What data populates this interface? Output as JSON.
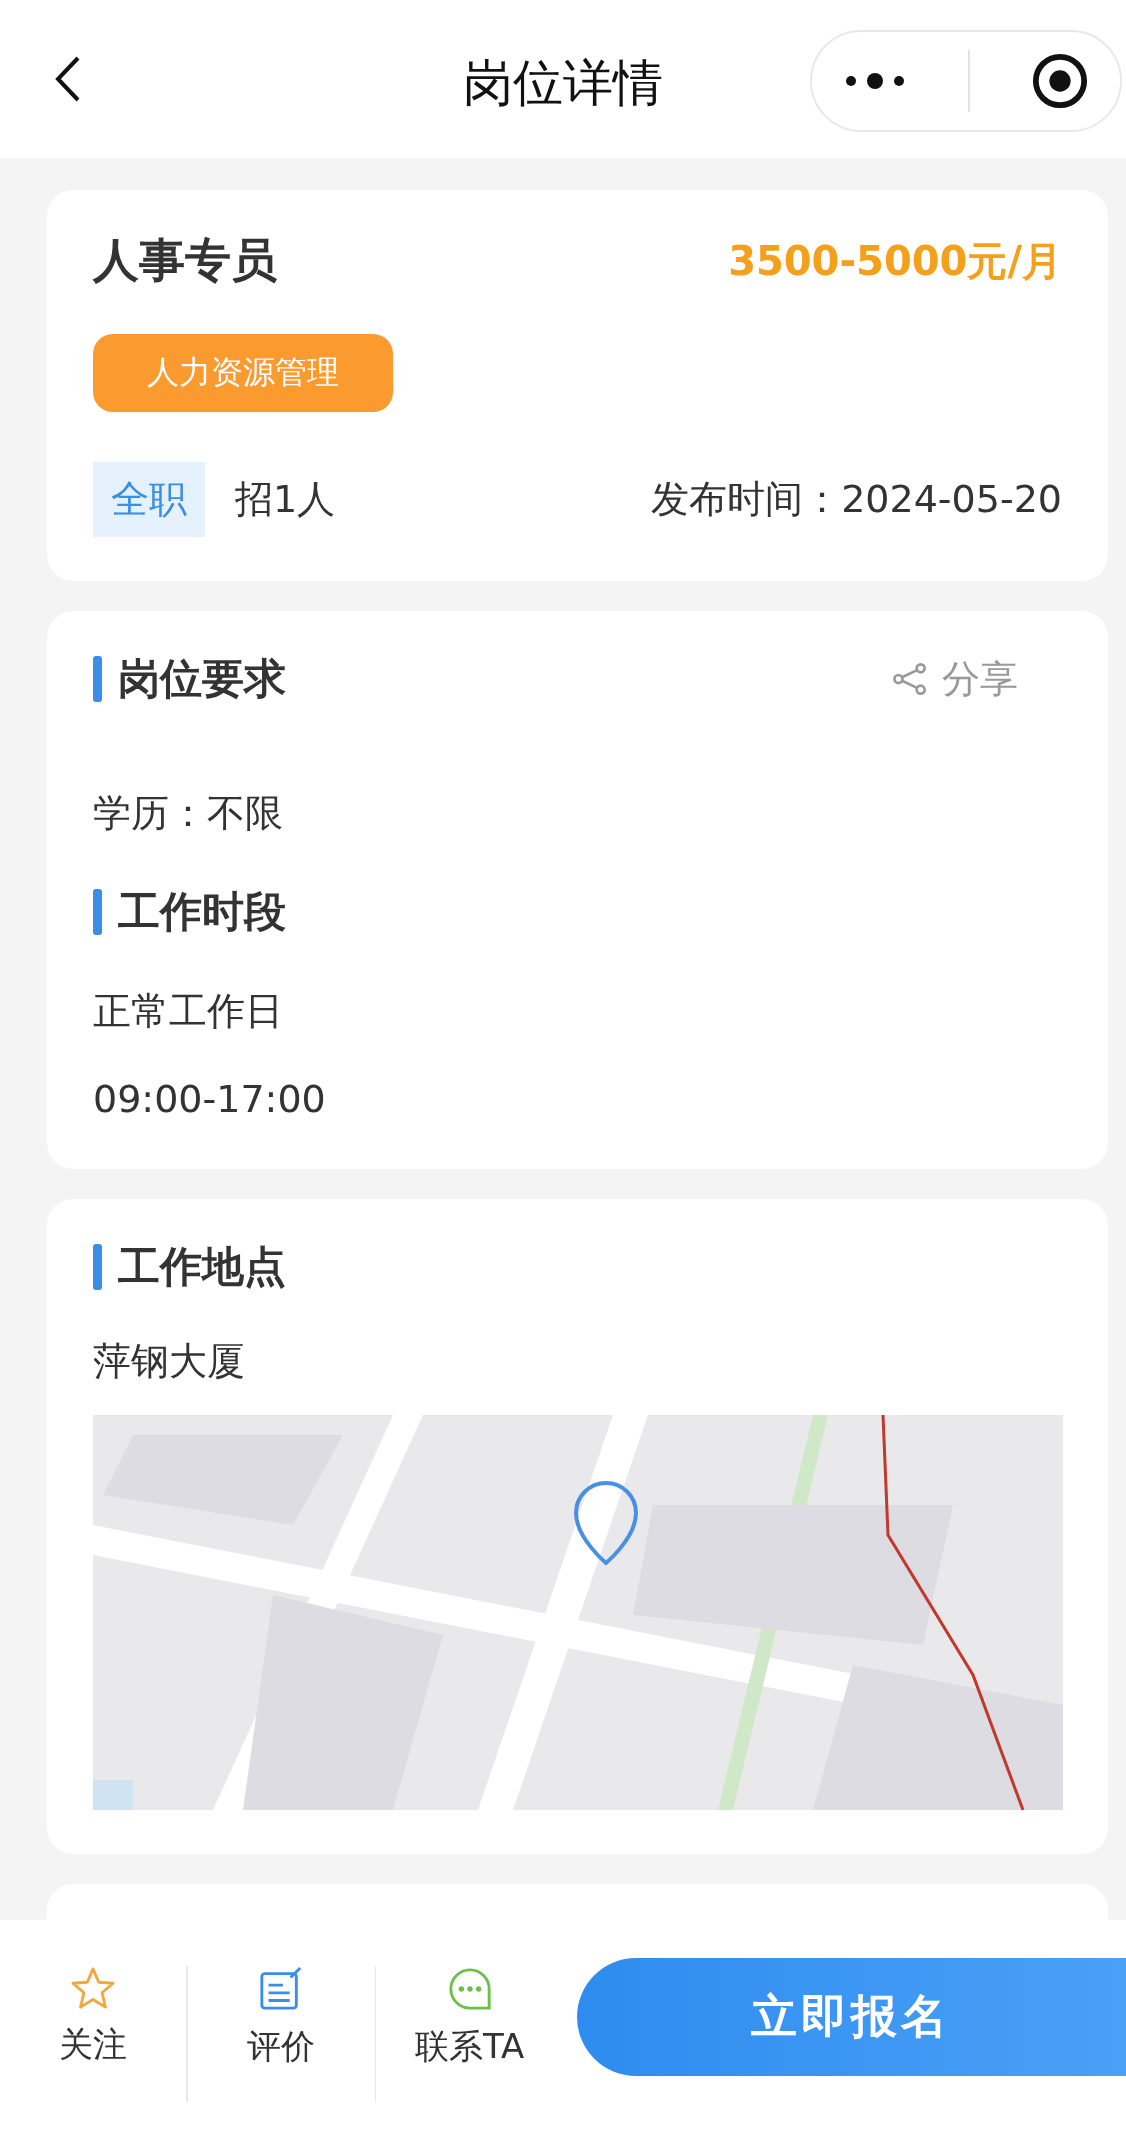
{
  "nav": {
    "title": "岗位详情"
  },
  "job": {
    "title": "人事专员",
    "salary": "3500-5000元/月",
    "category": "人力资源管理",
    "type": "全职",
    "headcount": "招1人",
    "published": "发布时间：2024-05-20"
  },
  "requirements": [
    {
      "kind": "heading",
      "text": "岗位要求",
      "action": "分享"
    },
    {
      "kind": "text",
      "text": "学历：不限"
    },
    {
      "kind": "heading",
      "text": "工作时段"
    },
    {
      "kind": "text",
      "text": "正常工作日"
    },
    {
      "kind": "text",
      "text": "09:00-17:00"
    }
  ],
  "location": {
    "heading": "工作地点",
    "place": "萍钢大厦"
  },
  "bottom_bar": {
    "actions": [
      {
        "kind": "star",
        "label": "关注"
      },
      {
        "kind": "note",
        "label": "评价"
      },
      {
        "kind": "chat",
        "label": "联系TA"
      }
    ],
    "primary": "立即报名"
  }
}
